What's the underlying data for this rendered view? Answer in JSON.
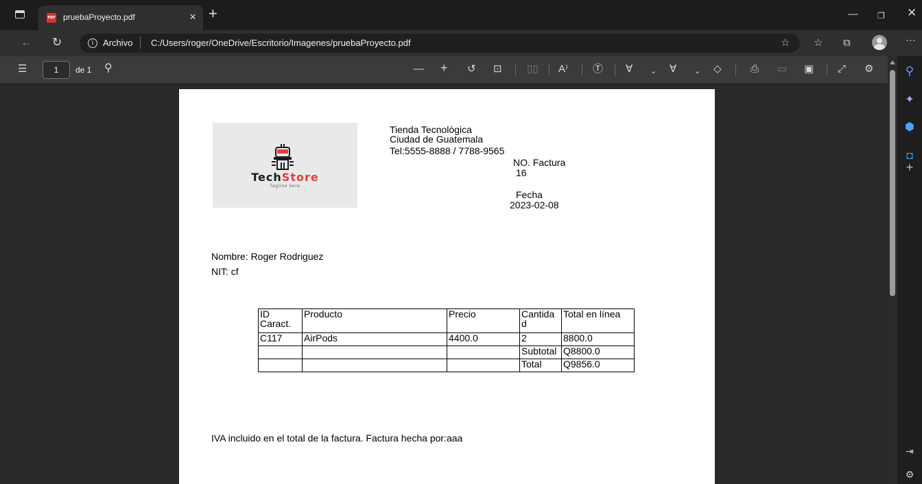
{
  "browser": {
    "tab_title": "pruebaProyecto.pdf",
    "tab_favicon_text": "PDF",
    "address_label": "Archivo",
    "url": "C:/Users/roger/OneDrive/Escritorio/Imagenes/pruebaProyecto.pdf"
  },
  "pdf_toolbar": {
    "page_number": "1",
    "page_of": "de 1"
  },
  "document": {
    "logo": {
      "name_part1": "Tech",
      "name_part2": "Store",
      "tagline": "Tagline here"
    },
    "store_name": "Tienda Tecnológica",
    "city": "Ciudad de Guatemala",
    "phone": "Tel:5555-8888 / 7788-9565",
    "invoice_label": "NO. Factura",
    "invoice_number": "16",
    "date_label": "Fecha",
    "date_value": "2023-02-08",
    "customer_name": "Nombre: Roger Rodriguez",
    "customer_nit": "NIT: cf",
    "table": {
      "headers": [
        "ID\nCaract.",
        "Producto",
        "Precio",
        "Cantida\nd",
        "Total en línea"
      ],
      "rows": [
        [
          "C117",
          "AirPods",
          "4400.0",
          "2",
          "8800.0"
        ],
        [
          "",
          "",
          "",
          "Subtotal",
          "Q8800.0"
        ],
        [
          "",
          "",
          "",
          "Total",
          "Q9856.0"
        ]
      ]
    },
    "footer": "IVA incluido en el total de la factura. Factura hecha por:aaa"
  },
  "colors": {
    "logo_accent": "#e2403a",
    "edge_accent_blue": "#4ea1ff",
    "copilot_purple": "#b69cff"
  }
}
